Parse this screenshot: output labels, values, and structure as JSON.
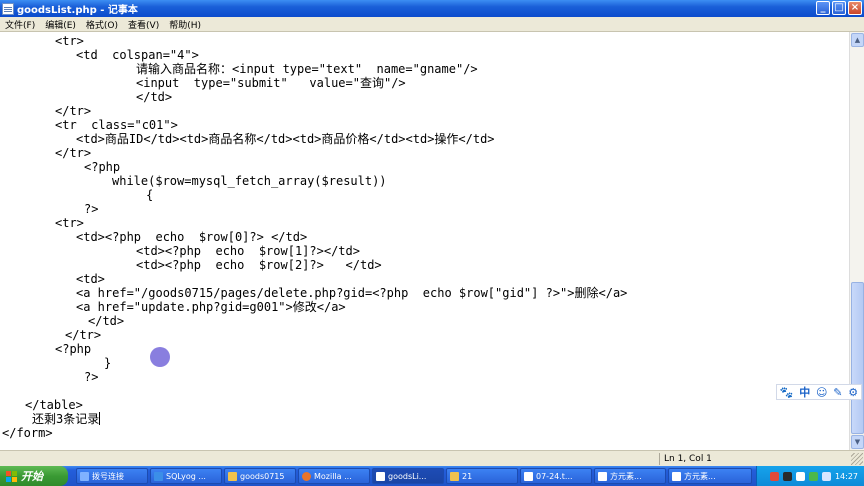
{
  "window": {
    "title": "goodsList.php - 记事本",
    "buttons": [
      "_",
      "□",
      "×"
    ]
  },
  "menu": [
    "文件(F)",
    "编辑(E)",
    "格式(O)",
    "查看(V)",
    "帮助(H)"
  ],
  "code_lines": [
    "<tr>",
    "<td  colspan=\"4\">",
    "请输入商品名称：<input type=\"text\"  name=\"gname\"/>",
    "<input  type=\"submit\"   value=\"查询\"/>",
    "</td>",
    "</tr>",
    "<tr  class=\"c01\">",
    "<td>商品ID</td><td>商品名称</td><td>商品价格</td><td>操作</td>",
    "</tr>",
    "<?php",
    "while($row=mysql_fetch_array($result))",
    "{",
    "?>",
    "<tr>",
    "<td><?php  echo  $row[0]?> </td>",
    "<td><?php  echo  $row[1]?></td>",
    "<td><?php  echo  $row[2]?>   </td>",
    "<td>",
    "<a href=\"/goods0715/pages/delete.php?gid=<?php  echo $row[\"gid\"] ?>\">删除</a>",
    "<a href=\"update.php?gid=g001\">修改</a>",
    "</td>",
    "</tr>",
    "<?php",
    "}",
    "?>",
    "",
    "</table>",
    "还剩3条记录",
    "</form>"
  ],
  "status": {
    "position": "Ln 1, Col 1"
  },
  "ime": [
    "🐾",
    "中",
    "☺",
    "✎",
    "⚙"
  ],
  "taskbar": {
    "start_label": "开始",
    "tasks": [
      {
        "label": "拨号连接",
        "color": "#7fb2ff"
      },
      {
        "label": "SQLyog ...",
        "color": "#3b8ee8"
      },
      {
        "label": "goods0715",
        "color": "#f0c24e"
      },
      {
        "label": "Mozilla ...",
        "color": "#e8742a"
      },
      {
        "label": "goodsLi...",
        "color": "#ffffff"
      },
      {
        "label": "21",
        "color": "#f0c24e"
      },
      {
        "label": "07-24.t...",
        "color": "#ffffff"
      },
      {
        "label": "方元素...",
        "color": "#ffffff"
      },
      {
        "label": "方元素...",
        "color": "#ffffff"
      }
    ],
    "clock": "14:27"
  }
}
